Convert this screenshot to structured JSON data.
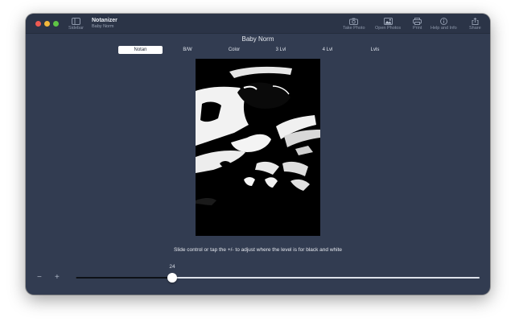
{
  "app": {
    "name": "Notanizer",
    "document": "Baby Norm"
  },
  "toolbar": {
    "sidebar_label": "Sidebar",
    "items": [
      {
        "label": "Take Photo",
        "icon": "camera-icon"
      },
      {
        "label": "Open Photos",
        "icon": "photos-icon"
      },
      {
        "label": "Print",
        "icon": "printer-icon"
      },
      {
        "label": "Help and Info",
        "icon": "info-icon"
      },
      {
        "label": "Share",
        "icon": "share-icon"
      }
    ]
  },
  "main": {
    "title": "Baby Norm",
    "tabs": [
      {
        "label": "Notan",
        "selected": true
      },
      {
        "label": "B/W",
        "selected": false
      },
      {
        "label": "Color",
        "selected": false
      },
      {
        "label": "3 Lvl",
        "selected": false
      },
      {
        "label": "4 Lvl",
        "selected": false
      },
      {
        "label": "Lvls",
        "selected": false
      }
    ],
    "hint": "Slide control or tap the +/- to adjust where the level is for black and white",
    "level": {
      "value": "24",
      "fraction": 0.24,
      "minus_label": "−",
      "plus_label": "+"
    }
  },
  "colors": {
    "window_bg": "#323c51",
    "titlebar_bg": "#2b3447",
    "selected_tab": "#ffffff",
    "slider_track": "#dde2ea",
    "slider_fill": "#0d1117"
  }
}
